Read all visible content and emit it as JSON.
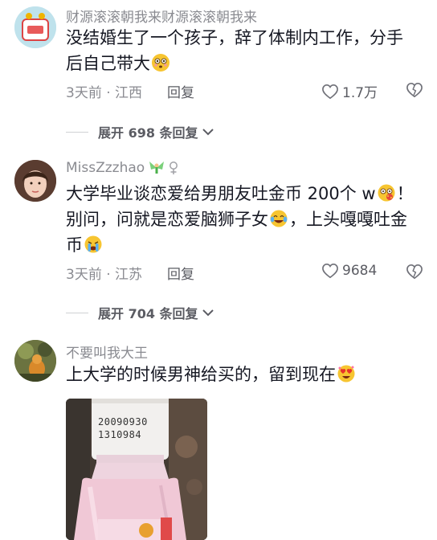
{
  "comments": [
    {
      "username": "财源滚滚朝我来财源滚滚朝我来",
      "text_line1": "没结婚生了一个孩子，辞了体制内工作，分手",
      "text_line2": "后自己带大",
      "time_location": "3天前 · 江西",
      "reply_label": "回复",
      "like_count": "1.7万",
      "expand_label": "展开 698 条回复"
    },
    {
      "username": "MissZzzhao",
      "text_line1": "大学毕业谈恋爱给男朋友吐金币 200个 w",
      "text_line1_end": "！",
      "text_line2": "别问，问就是恋爱脑狮子女",
      "text_line2_end": "，上头嘎嘎吐金",
      "text_line3": "币",
      "time_location": "3天前 · 江苏",
      "reply_label": "回复",
      "like_count": "9684",
      "expand_label": "展开 704 条回复"
    },
    {
      "username": "不要叫我大王",
      "text_line1": "上大学的时候男神给买的，留到现在"
    }
  ],
  "photo": {
    "print_line1": "20090930",
    "print_line2": "1310984"
  },
  "icons": {
    "heart": "heart-icon",
    "dislike": "broken-heart-icon",
    "chevron": "chevron-down-icon",
    "fairy": "fairy-emoji",
    "female": "female-sign-icon"
  }
}
